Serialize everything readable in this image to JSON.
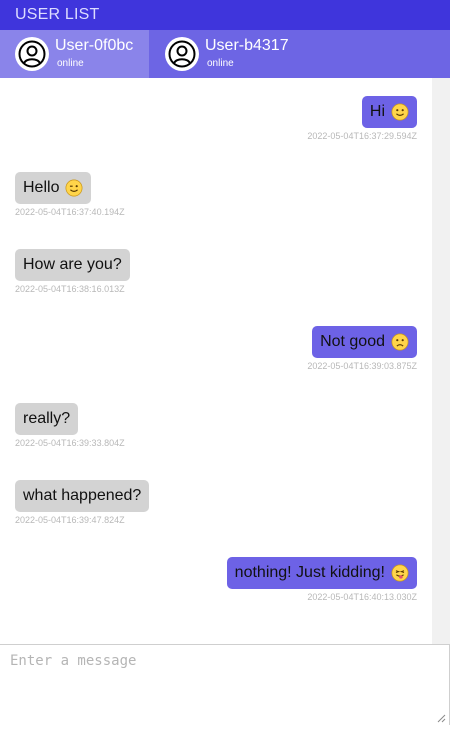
{
  "header": {
    "title": "USER LIST"
  },
  "users": [
    {
      "name": "User-0f0bc",
      "status": "online",
      "icon": "user-avatar-icon"
    },
    {
      "name": "User-b4317",
      "status": "online",
      "icon": "user-avatar-icon"
    }
  ],
  "messages": [
    {
      "text": "Hi",
      "time": "2022-05-04T16:37:29.594Z",
      "side": "sent",
      "emoji": "smile"
    },
    {
      "text": "Hello",
      "time": "2022-05-04T16:37:40.194Z",
      "side": "received",
      "emoji": "wink"
    },
    {
      "text": "How are you?",
      "time": "2022-05-04T16:38:16.013Z",
      "side": "received",
      "emoji": ""
    },
    {
      "text": "Not good",
      "time": "2022-05-04T16:39:03.875Z",
      "side": "sent",
      "emoji": "frown"
    },
    {
      "text": "really?",
      "time": "2022-05-04T16:39:33.804Z",
      "side": "received",
      "emoji": ""
    },
    {
      "text": "what happened?",
      "time": "2022-05-04T16:39:47.824Z",
      "side": "received",
      "emoji": ""
    },
    {
      "text": "nothing! Just kidding!",
      "time": "2022-05-04T16:40:13.030Z",
      "side": "sent",
      "emoji": "tongue"
    }
  ],
  "composer": {
    "placeholder": "Enter a message"
  },
  "colors": {
    "topbar": "#3f35dc",
    "userbar": "#6d65e4",
    "active_user": "#8a84ea",
    "sent_bubble": "#6d62e6",
    "received_bubble": "#d3d3d3"
  }
}
